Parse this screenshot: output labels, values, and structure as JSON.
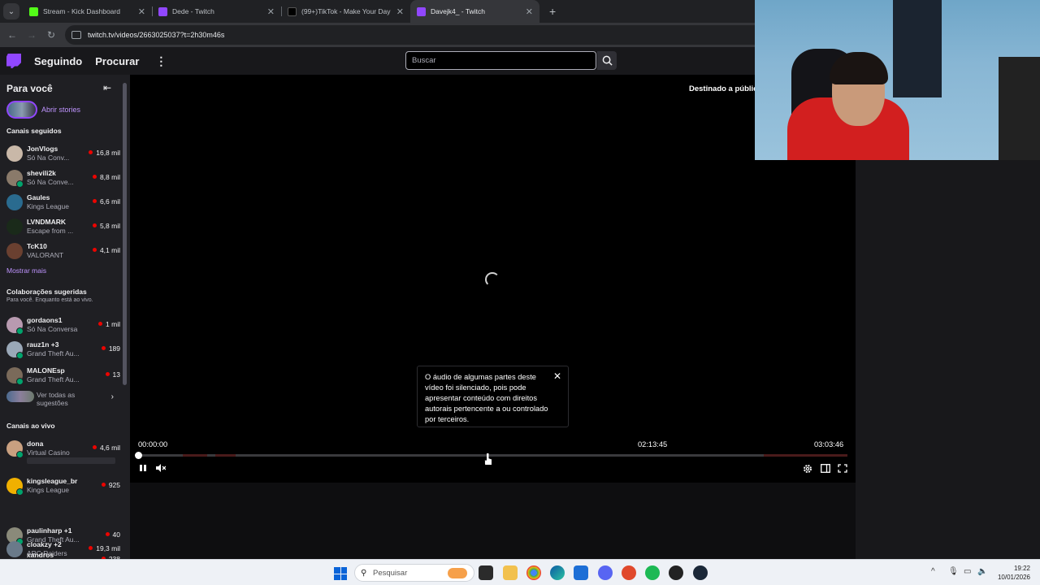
{
  "browser": {
    "tabs": [
      {
        "label": "Stream - Kick Dashboard",
        "icon_color": "#53fc18",
        "active": false
      },
      {
        "label": "Dede - Twitch",
        "icon_color": "#9147ff",
        "active": false
      },
      {
        "label": "(99+)TikTok - Make Your Day",
        "icon_color": "#000000",
        "active": false
      },
      {
        "label": "Davejk4_ - Twitch",
        "icon_color": "#9147ff",
        "active": true
      }
    ],
    "url": "twitch.tv/videos/2663025037?t=2h30m46s"
  },
  "twitch_nav": {
    "following": "Seguindo",
    "browse": "Procurar",
    "search_placeholder": "Buscar"
  },
  "sidebar": {
    "title": "Para você",
    "stories_label": "Abrir stories",
    "followed_title": "Canais seguidos",
    "followed": [
      {
        "name": "JonVlogs",
        "category": "Só Na Conv...",
        "viewers": "16,8 mil"
      },
      {
        "name": "shevili2k",
        "category": "Só Na Conve...",
        "viewers": "8,8 mil"
      },
      {
        "name": "Gaules",
        "category": "Kings League",
        "viewers": "6,6 mil"
      },
      {
        "name": "LVNDMARK",
        "category": "Escape from ...",
        "viewers": "5,8 mil"
      },
      {
        "name": "TcK10",
        "category": "VALORANT",
        "viewers": "4,1 mil"
      }
    ],
    "show_more": "Mostrar mais",
    "collab_title": "Colaborações sugeridas",
    "collab_sub": "Para você. Enquanto está ao vivo.",
    "collabs": [
      {
        "name": "gordaons1",
        "category": "Só Na Conversa",
        "viewers": "1 mil"
      },
      {
        "name": "rauz1n +3",
        "category": "Grand Theft Au...",
        "viewers": "189"
      },
      {
        "name": "MALONEsp",
        "category": "Grand Theft Au...",
        "viewers": "13"
      }
    ],
    "see_all": "Ver todas as sugestões",
    "live_title": "Canais ao vivo",
    "live": [
      {
        "name": "dona",
        "category": "Virtual Casino",
        "viewers": "4,6 mil"
      },
      {
        "name": "kingsleague_br",
        "category": "Kings League",
        "viewers": "925"
      },
      {
        "name": "paulinharp +1",
        "category": "Grand Theft Au...",
        "viewers": "40"
      },
      {
        "name": "cloakzy +2",
        "category": "ARC Raiders",
        "viewers": "19,3 mil"
      },
      {
        "name": "xandros",
        "category": "",
        "viewers": "238"
      }
    ]
  },
  "player": {
    "audience_label": "Destinado a públic",
    "muted_notice": "O áudio de algumas partes deste vídeo foi silenciado, pois pode apresentar conteúdo com direitos autorais pertencente a ou controlado por terceiros.",
    "time_current": "00:00:00",
    "time_hover": "02:13:45",
    "time_total": "03:03:46",
    "progress": 0.0,
    "hover_position": 0.73
  },
  "taskbar": {
    "search_placeholder": "Pesquisar",
    "time": "19:22",
    "date": "10/01/2026"
  }
}
